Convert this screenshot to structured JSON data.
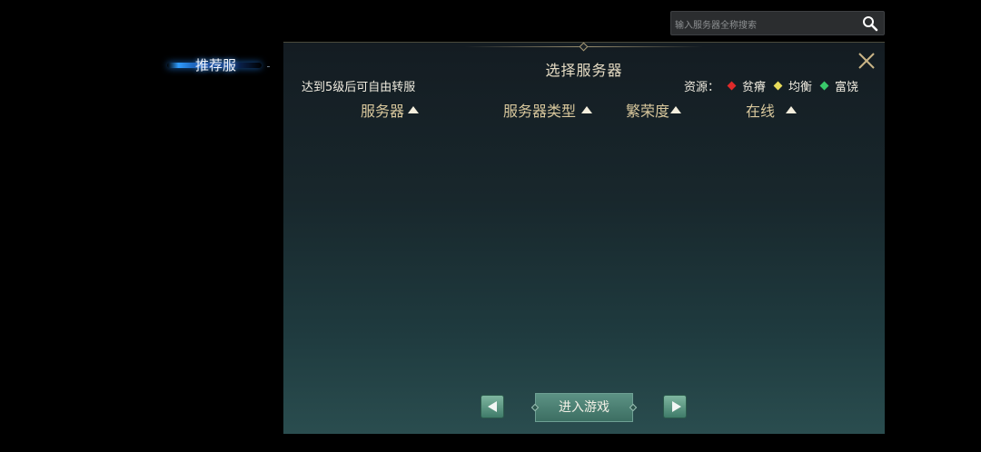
{
  "search": {
    "placeholder": "输入服务器全称搜索",
    "icon": "search-icon"
  },
  "sidebar": {
    "tabs": [
      {
        "label": "推荐服",
        "active": true
      }
    ]
  },
  "panel": {
    "title": "选择服务器",
    "hint": "达到5级后可自由转服",
    "resources": {
      "label": "资源：",
      "levels": [
        {
          "label": "贫瘠",
          "color": "#e02a2a"
        },
        {
          "label": "均衡",
          "color": "#e8dc5a"
        },
        {
          "label": "富饶",
          "color": "#39c96a"
        }
      ]
    },
    "columns": [
      {
        "label": "服务器",
        "sort": "asc"
      },
      {
        "label": "服务器类型",
        "sort": "asc"
      },
      {
        "label": "繁荣度",
        "sort": "asc"
      },
      {
        "label": "在线",
        "sort": "asc"
      }
    ],
    "rows": []
  },
  "footer": {
    "enter_label": "进入游戏",
    "prev_icon": "prev-page-icon",
    "next_icon": "next-page-icon"
  }
}
